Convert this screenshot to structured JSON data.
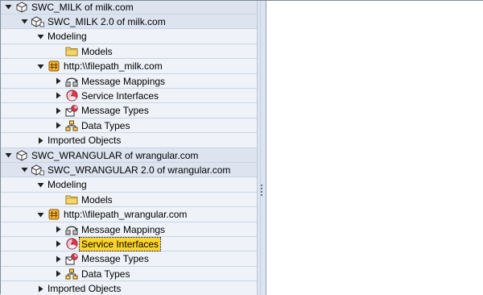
{
  "tree": {
    "nodes": [
      {
        "label": "SWC_MILK of milk.com",
        "icon": "software-component-icon",
        "expanded": true,
        "level": 0
      },
      {
        "label": "SWC_MILK 2.0 of milk.com",
        "icon": "software-component-version-icon",
        "expanded": true,
        "level": 1
      },
      {
        "label": "Modeling",
        "icon": "",
        "expanded": true,
        "level": 2
      },
      {
        "label": "Models",
        "icon": "folder-icon",
        "expanded": null,
        "level": 3
      },
      {
        "label": "http:\\\\filepath_milk.com",
        "icon": "namespace-icon",
        "expanded": true,
        "level": 2
      },
      {
        "label": "Message Mappings",
        "icon": "message-mapping-icon",
        "expanded": false,
        "level": 3
      },
      {
        "label": "Service Interfaces",
        "icon": "service-interface-icon",
        "expanded": false,
        "level": 3
      },
      {
        "label": "Message Types",
        "icon": "message-type-icon",
        "expanded": false,
        "level": 3
      },
      {
        "label": "Data Types",
        "icon": "data-type-icon",
        "expanded": false,
        "level": 3
      },
      {
        "label": "Imported Objects",
        "icon": "",
        "expanded": false,
        "level": 2
      },
      {
        "label": "SWC_WRANGULAR of wrangular.com",
        "icon": "software-component-icon",
        "expanded": true,
        "level": 0
      },
      {
        "label": "SWC_WRANGULAR 2.0 of wrangular.com",
        "icon": "software-component-version-icon",
        "expanded": true,
        "level": 1
      },
      {
        "label": "Modeling",
        "icon": "",
        "expanded": true,
        "level": 2
      },
      {
        "label": "Models",
        "icon": "folder-icon",
        "expanded": null,
        "level": 3
      },
      {
        "label": "http:\\\\filepath_wrangular.com",
        "icon": "namespace-icon",
        "expanded": true,
        "level": 2
      },
      {
        "label": "Message Mappings",
        "icon": "message-mapping-icon",
        "expanded": false,
        "level": 3
      },
      {
        "label": "Service Interfaces",
        "icon": "service-interface-icon",
        "expanded": false,
        "level": 3,
        "selected": true
      },
      {
        "label": "Message Types",
        "icon": "message-type-icon",
        "expanded": false,
        "level": 3
      },
      {
        "label": "Data Types",
        "icon": "data-type-icon",
        "expanded": false,
        "level": 3
      },
      {
        "label": "Imported Objects",
        "icon": "",
        "expanded": false,
        "level": 2
      }
    ]
  },
  "colors": {
    "tree_background": "#eff2f8",
    "tree_row_alt": "#dde4f0",
    "selection": "#ffd42a",
    "folder": "#f6d66a",
    "namespace": "#e8a317",
    "service_interface": "#d9364a"
  }
}
